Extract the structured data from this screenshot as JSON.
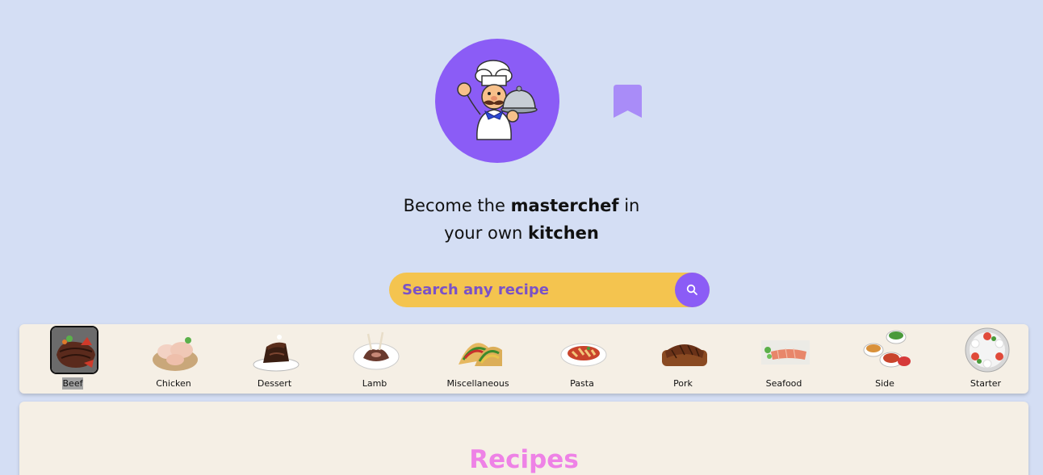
{
  "header": {
    "logo_alt": "chef-logo",
    "bookmark_icon": "bookmark-icon"
  },
  "tagline": {
    "line1_pre": "Become the ",
    "line1_bold": "masterchef",
    "line1_post": " in",
    "line2_pre": "your own ",
    "line2_bold": "kitchen"
  },
  "search": {
    "placeholder": "Search any recipe",
    "button_icon": "search-icon"
  },
  "categories": {
    "active": "Beef",
    "items": [
      {
        "label": "Beef"
      },
      {
        "label": "Chicken"
      },
      {
        "label": "Dessert"
      },
      {
        "label": "Lamb"
      },
      {
        "label": "Miscellaneous"
      },
      {
        "label": "Pasta"
      },
      {
        "label": "Pork"
      },
      {
        "label": "Seafood"
      },
      {
        "label": "Side"
      },
      {
        "label": "Starter"
      }
    ]
  },
  "recipes": {
    "title": "Recipes"
  },
  "colors": {
    "background": "#d4def4",
    "accent": "#8b5cf6",
    "search_bg": "#f4c44f",
    "panel_bg": "#f5efe5",
    "recipes_title": "#ee82e6"
  }
}
